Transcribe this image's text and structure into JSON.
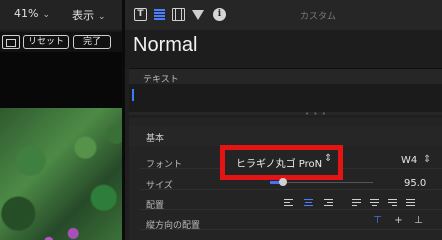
{
  "viewer": {
    "zoom": "41%",
    "view_menu": "表示",
    "reset_label": "リセット",
    "done_label": "完了"
  },
  "inspector": {
    "mode_label": "カスタム",
    "title_name": "Normal",
    "text_section": "テキスト",
    "basic_section": "基本",
    "font_label": "フォント",
    "font_family": "ヒラギノ丸ゴ ProN",
    "font_weight": "W4",
    "size_label": "サイズ",
    "size_value": "95.0",
    "align_label": "配置",
    "valign_label": "縦方向の配置",
    "stepper_glyph": "⌃⌄"
  },
  "colors": {
    "highlight": "#e51414",
    "accent": "#4a7dff"
  }
}
